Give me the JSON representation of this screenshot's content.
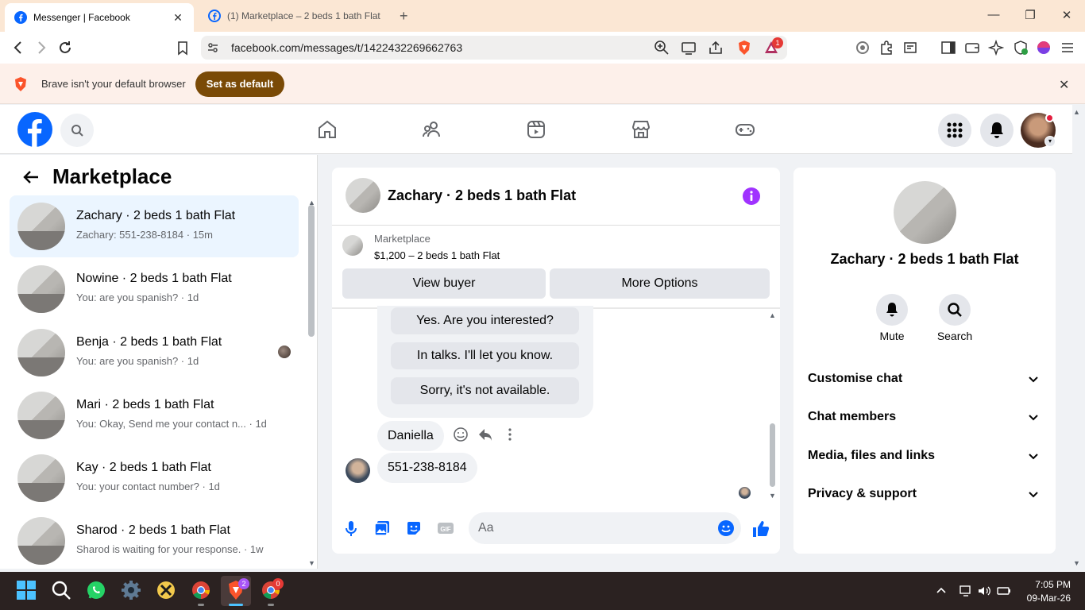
{
  "browser": {
    "tabs": [
      {
        "title": "Messenger | Facebook",
        "active": true
      },
      {
        "title": "(1) Marketplace – 2 beds 1 bath Flat |",
        "active": false
      }
    ],
    "url": "facebook.com/messages/t/1422432269662763",
    "notification_count": "1",
    "infobar": {
      "text": "Brave isn't your default browser",
      "button": "Set as default"
    }
  },
  "facebook": {
    "nav_icons": [
      "home-icon",
      "friends-icon",
      "video-icon",
      "marketplace-icon",
      "gaming-icon"
    ],
    "left_panel": {
      "title": "Marketplace",
      "conversations": [
        {
          "name": "Zachary · 2 beds 1 bath Flat",
          "preview": "Zachary: 551-238-8184 · 15m",
          "selected": true
        },
        {
          "name": "Nowine · 2 beds 1 bath Flat",
          "preview": "You: are you spanish? · 1d",
          "selected": false
        },
        {
          "name": "Benja · 2 beds 1 bath Flat",
          "preview": "You: are you spanish? · 1d",
          "selected": false
        },
        {
          "name": "Mari · 2 beds 1 bath Flat",
          "preview": "You: Okay, Send me your contact n... · 1d",
          "selected": false
        },
        {
          "name": "Kay · 2 beds 1 bath Flat",
          "preview": "You: your contact number? · 1d",
          "selected": false
        },
        {
          "name": "Sharod · 2 beds 1 bath Flat",
          "preview": "Sharod is waiting for your response. · 1w",
          "selected": false
        }
      ]
    },
    "chat": {
      "title": "Zachary · 2 beds 1 bath Flat",
      "marketplace_label": "Marketplace",
      "marketplace_item": "$1,200 – 2 beds 1 bath Flat",
      "buttons": [
        "View buyer",
        "More Options"
      ],
      "quick_replies": [
        "Yes. Are you interested?",
        "In talks. I'll let you know.",
        "Sorry, it's not available."
      ],
      "messages": [
        {
          "text": "Daniella"
        },
        {
          "text": "551-238-8184"
        }
      ],
      "composer_placeholder": "Aa"
    },
    "right_panel": {
      "name": "Zachary · 2 beds 1 bath Flat",
      "actions": [
        "Mute",
        "Search"
      ],
      "sections": [
        "Customise chat",
        "Chat members",
        "Media, files and links",
        "Privacy & support"
      ]
    }
  },
  "taskbar": {
    "time": "7:05 PM",
    "date": "09-Mar-26",
    "brave_badge": "2",
    "chrome_badge": "0"
  },
  "colors": {
    "fb_blue": "#0866ff",
    "messenger_purple": "#a033ff",
    "selected_bg": "#ebf5ff",
    "brave_button": "#7a4a06",
    "taskbar": "#2b2221"
  }
}
